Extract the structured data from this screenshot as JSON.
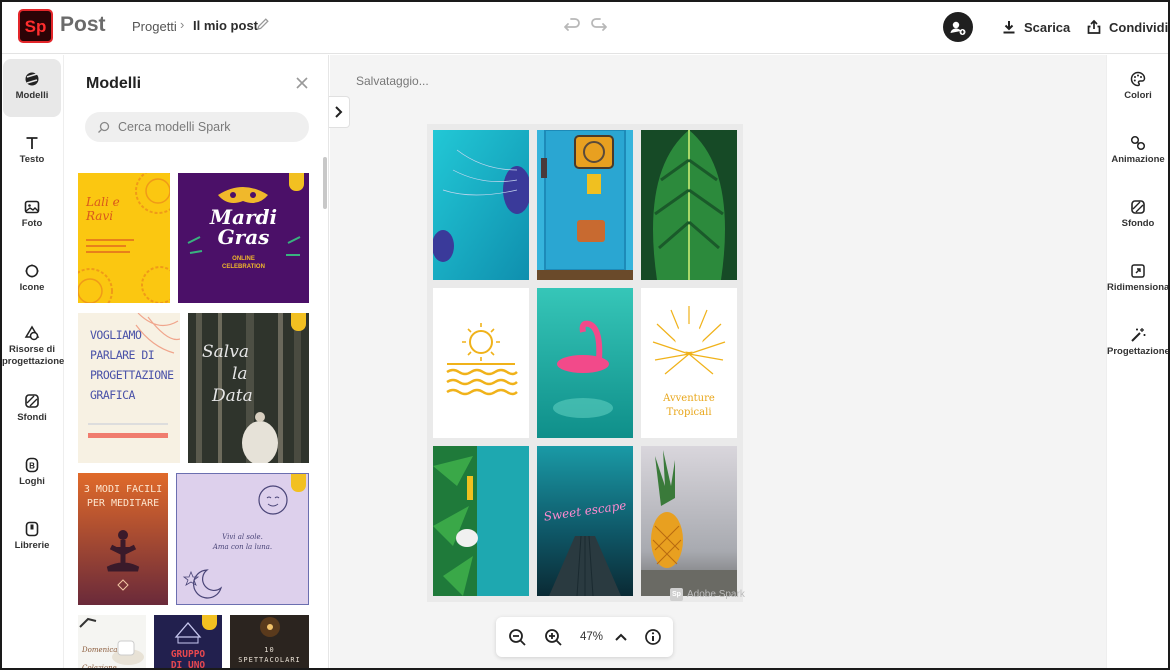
{
  "app": {
    "logo_text": "Sp",
    "name": "Post"
  },
  "breadcrumb": {
    "parent": "Progetti",
    "current": "Il mio post"
  },
  "header": {
    "download_label": "Scarica",
    "share_label": "Condividi"
  },
  "left_rail": {
    "items": [
      {
        "label": "Modelli",
        "icon": "templates-icon"
      },
      {
        "label": "Testo",
        "icon": "text-icon"
      },
      {
        "label": "Foto",
        "icon": "photo-icon"
      },
      {
        "label": "Icone",
        "icon": "icons-icon"
      },
      {
        "label": "Risorse di progettazione",
        "icon": "design-assets-icon"
      },
      {
        "label": "Sfondi",
        "icon": "backgrounds-icon"
      },
      {
        "label": "Loghi",
        "icon": "logos-icon"
      },
      {
        "label": "Librerie",
        "icon": "libraries-icon"
      }
    ]
  },
  "panel": {
    "title": "Modelli",
    "search_placeholder": "Cerca modelli Spark",
    "templates": {
      "t1": {
        "line1": "Lali e",
        "line2": "Ravi"
      },
      "t2": {
        "line1": "Mardi",
        "line2": "Gras",
        "line3": "ONLINE",
        "line4": "CELEBRATION"
      },
      "t3": {
        "line1": "VOGLIAMO",
        "line2": "PARLARE DI",
        "line3": "PROGETTAZIONE",
        "line4": "GRAFICA"
      },
      "t4": {
        "line1": "Salva",
        "line2": "la",
        "line3": "Data"
      },
      "t5": {
        "line1": "3 MODI FACILI",
        "line2": "PER MEDITARE"
      },
      "t6": {
        "line1": "Vivi al sole.",
        "line2": "Ama con la luna."
      },
      "t7": {
        "line1": "Domenica",
        "line2": "Colazione"
      },
      "t8": {
        "line1": "GRUPPO",
        "line2": "DI UNO"
      },
      "t9": {
        "line1": "10",
        "line2": "SPETTACOLARI"
      }
    }
  },
  "canvas": {
    "status": "Salvataggio...",
    "tile_texts": {
      "tropical_line1": "Avventure",
      "tropical_line2": "Tropicali",
      "neon": "Sweet escape"
    },
    "watermark": "Adobe Spark",
    "watermark_logo": "Sp"
  },
  "zoom": {
    "value": "47%"
  },
  "right_rail": {
    "items": [
      {
        "label": "Colori",
        "icon": "palette-icon"
      },
      {
        "label": "Animazione",
        "icon": "animation-icon"
      },
      {
        "label": "Sfondo",
        "icon": "background-icon"
      },
      {
        "label": "Ridimensiona",
        "icon": "resize-icon"
      },
      {
        "label": "Progettazione",
        "icon": "magic-wand-icon"
      }
    ]
  },
  "colors": {
    "brand": "#e3262a",
    "crown": "#f2c021"
  }
}
